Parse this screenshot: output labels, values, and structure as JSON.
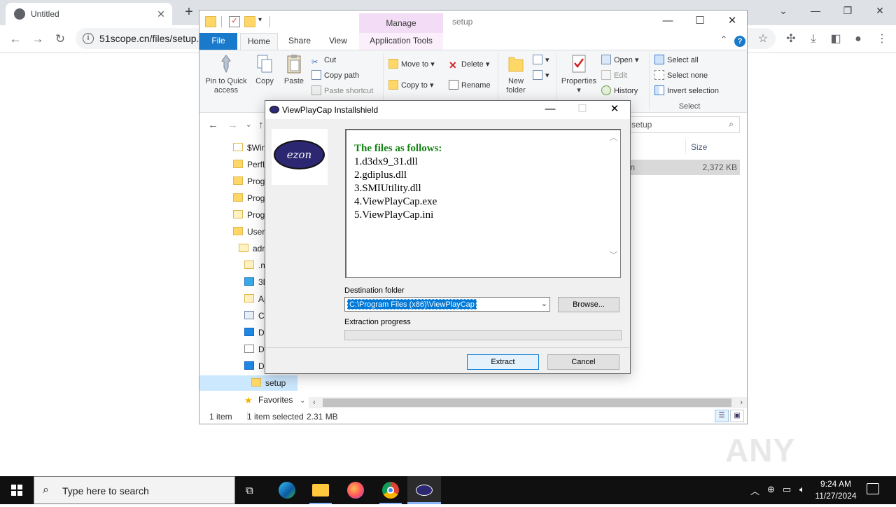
{
  "browser": {
    "tab_title": "Untitled",
    "tab_close": "✕",
    "new_tab": "+",
    "url": "51scope.cn/files/setup.r",
    "win_buttons": [
      "⌄",
      "—",
      "❐",
      "✕"
    ]
  },
  "explorer": {
    "title": "setup",
    "manage_tab": "Manage",
    "ribbon_tabs": [
      "File",
      "Home",
      "Share",
      "View",
      "Application Tools"
    ],
    "clipboard": {
      "pin_label": "Pin to Quick access",
      "copy_label": "Copy",
      "paste_label": "Paste",
      "cut_label": "Cut",
      "copy_path_label": "Copy path",
      "paste_shortcut_label": "Paste shortcut"
    },
    "organize": {
      "move_to": "Move to",
      "copy_to": "Copy to",
      "delete": "Delete",
      "rename": "Rename"
    },
    "new": {
      "new_folder": "New folder"
    },
    "open": {
      "properties": "Properties",
      "open": "Open",
      "edit": "Edit",
      "history": "History"
    },
    "select": {
      "select_all": "Select all",
      "select_none": "Select none",
      "invert_selection": "Invert selection",
      "group_label": "Select"
    },
    "search_placeholder": "setup",
    "nav_items": [
      "$Win",
      "PerfL",
      "Prog",
      "Prog",
      "Prog",
      "Users",
      "adn",
      ".m",
      "3D",
      "Ap",
      "Co",
      "De",
      "Do",
      "Do",
      "setup",
      "Favorites"
    ],
    "columns": {
      "size": "Size"
    },
    "file": {
      "type": "ation",
      "size": "2,372 KB"
    },
    "status": {
      "count": "1 item",
      "selected": "1 item selected",
      "size": "2.31 MB"
    }
  },
  "dialog": {
    "title": "ViewPlayCap Installshield",
    "logo_text": "ezon",
    "heading": "The files as follows:",
    "files": [
      "1.d3dx9_31.dll",
      "2.gdiplus.dll",
      "3.SMIUtility.dll",
      "4.ViewPlayCap.exe",
      "5.ViewPlayCap.ini"
    ],
    "dest_label": "Destination folder",
    "dest_value": "C:\\Program Files (x86)\\ViewPlayCap",
    "browse": "Browse...",
    "progress_label": "Extraction progress",
    "progress_value": 0,
    "extract": "Extract",
    "cancel": "Cancel"
  },
  "watermark": {
    "text": "ANY RUN"
  },
  "taskbar": {
    "search_placeholder": "Type here to search",
    "time": "9:24 AM",
    "date": "11/27/2024"
  },
  "colors": {
    "heading_green": "#128212",
    "selection_blue": "#0078d7",
    "manage_band": "#f3dcf5"
  }
}
